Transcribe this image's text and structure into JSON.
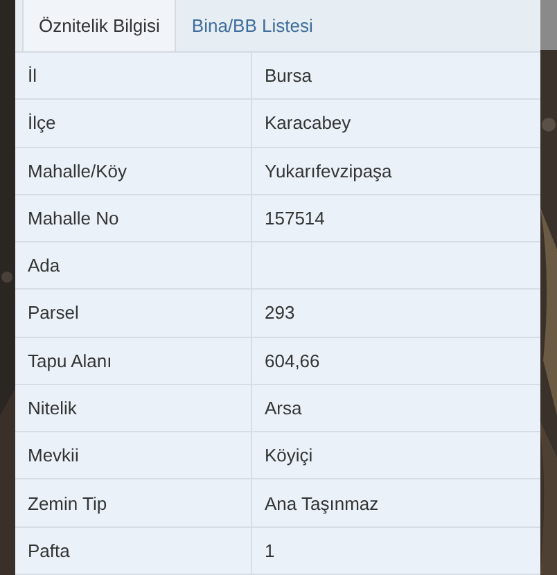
{
  "tabs": [
    {
      "label": "Öznitelik Bilgisi",
      "selected": true
    },
    {
      "label": "Bina/BB Listesi",
      "selected": false
    }
  ],
  "table": {
    "rows": [
      {
        "label": "İl",
        "value": "Bursa"
      },
      {
        "label": "İlçe",
        "value": "Karacabey"
      },
      {
        "label": "Mahalle/Köy",
        "value": "Yukarıfevzipaşa"
      },
      {
        "label": "Mahalle No",
        "value": "157514"
      },
      {
        "label": "Ada"
      },
      {
        "label": "Parsel",
        "value": "293"
      },
      {
        "label": "Tapu Alanı",
        "value": "604,66"
      },
      {
        "label": "Nitelik",
        "value": "Arsa"
      },
      {
        "label": "Mevkii",
        "value": "Köyiçi"
      },
      {
        "label": "Zemin Tip",
        "value": "Ana Taşınmaz"
      },
      {
        "label": "Pafta",
        "value": "1"
      }
    ]
  }
}
